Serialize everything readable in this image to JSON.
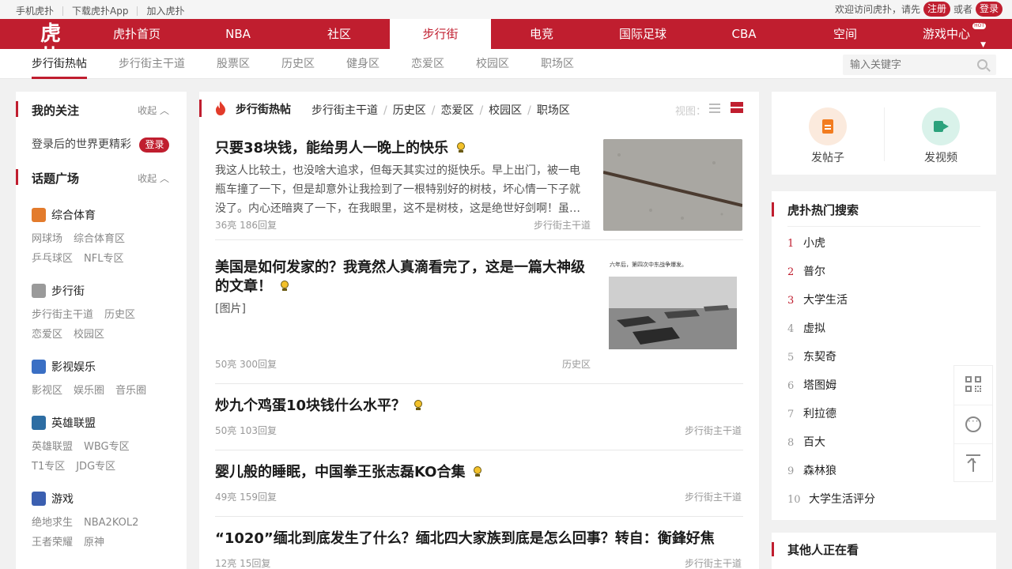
{
  "topbar": {
    "links": [
      "手机虎扑",
      "下载虎扑App",
      "加入虎扑"
    ],
    "welcome": "欢迎访问虎扑，请先",
    "register": "注册",
    "or": "或者",
    "login": "登录"
  },
  "mainnav": {
    "logo": "虎扑",
    "items": [
      "虎扑首页",
      "NBA",
      "社区",
      "步行街",
      "电竞",
      "国际足球",
      "CBA",
      "空间",
      "游戏中心"
    ],
    "active": "步行街",
    "hot_badge": "HOT"
  },
  "subnav": {
    "items": [
      "步行街热帖",
      "步行街主干道",
      "股票区",
      "历史区",
      "健身区",
      "恋爱区",
      "校园区",
      "职场区"
    ],
    "search_placeholder": "输入关键字"
  },
  "sidebar": {
    "follow_title": "我的关注",
    "collapse": "收起",
    "login_tip": "登录后的世界更精彩",
    "login_button": "登录",
    "topics_title": "话题广场",
    "topics": [
      {
        "name": "综合体育",
        "color": "#e37b2c",
        "subs": [
          "网球场",
          "综合体育区",
          "乒乓球区",
          "NFL专区"
        ]
      },
      {
        "name": "步行街",
        "color": "#9a9a9a",
        "subs": [
          "步行街主干道",
          "历史区",
          "恋爱区",
          "校园区"
        ]
      },
      {
        "name": "影视娱乐",
        "color": "#3a6fc4",
        "subs": [
          "影视区",
          "娱乐圈",
          "音乐圈"
        ]
      },
      {
        "name": "英雄联盟",
        "color": "#2d6da3",
        "subs": [
          "英雄联盟",
          "WBG专区",
          "T1专区",
          "JDG专区"
        ]
      },
      {
        "name": "游戏",
        "color": "#3b5fb0",
        "subs": [
          "绝地求生",
          "NBA2KOL2",
          "王者荣耀",
          "原神"
        ]
      }
    ]
  },
  "feed": {
    "title": "步行街热帖",
    "crumbs": [
      "步行街主干道",
      "历史区",
      "恋爱区",
      "校园区",
      "职场区"
    ],
    "view_label": "视图：",
    "posts": [
      {
        "title": "只要38块钱，能给男人一晚上的快乐",
        "body": "我这人比较土，也没啥大追求，但每天其实过的挺快乐。早上出门，被一电瓶车撞了一下，但是却意外让我捡到了一根特别好的树枝，坏心情一下子就没了。内心还暗爽了一下，在我眼里，这不是树枝，这是绝世好剑啊！虽…",
        "meta": "36亮 186回复",
        "board": "步行街主干道"
      },
      {
        "title": "美国是如何发家的？我竟然人真滴看完了，这是一篇大神级的文章！",
        "body": "[图片]",
        "meta": "50亮 300回复",
        "board": "历史区",
        "thumb_caption": "六年后，第四次中东战争爆发。"
      },
      {
        "title": "炒九个鸡蛋10块钱什么水平？",
        "meta": "50亮 103回复",
        "board": "步行街主干道"
      },
      {
        "title": "婴儿般的睡眠，中国拳王张志磊KO合集",
        "meta": "49亮 159回复",
        "board": "步行街主干道"
      },
      {
        "title": "“1020”缅北到底发生了什么？缅北四大家族到底是怎么回事？转自：衡鋒好焦",
        "meta": "12亮 15回复",
        "board": "步行街主干道"
      }
    ]
  },
  "actions": {
    "post": "发帖子",
    "video": "发视频"
  },
  "hotsearch": {
    "title": "虎扑热门搜索",
    "items": [
      "小虎",
      "普尔",
      "大学生活",
      "虚拟",
      "东契奇",
      "塔图姆",
      "利拉德",
      "百大",
      "森林狼",
      "大学生活评分"
    ]
  },
  "others": {
    "title": "其他人正在看"
  },
  "colors": {
    "brand": "#c01e2f"
  }
}
